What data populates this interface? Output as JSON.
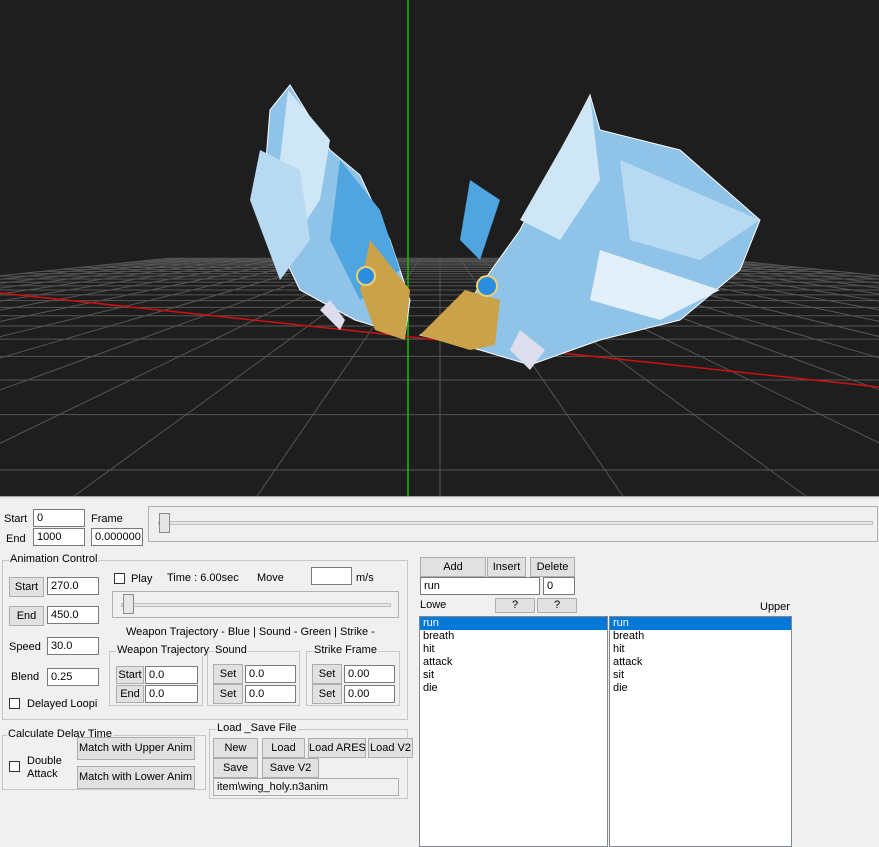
{
  "timeline": {
    "start_label": "Start",
    "start_value": "0",
    "end_label": "End",
    "end_value": "1000",
    "frame_label": "Frame",
    "frame_value": "0.000000"
  },
  "animation_control": {
    "title": "Animation Control",
    "start_button": "Start",
    "start_value": "270.0",
    "end_button": "End",
    "end_value": "450.0",
    "speed_label": "Speed",
    "speed_value": "30.0",
    "blend_label": "Blend",
    "blend_value": "0.25",
    "delayed_loop_label": "Delayed Loopi",
    "play_label": "Play",
    "time_label": "Time : 6.00sec",
    "move_label": "Move",
    "move_value": "",
    "move_unit": "m/s",
    "legend_text": "Weapon Trajectory - Blue | Sound - Green | Strike -",
    "weapon_trajectory": {
      "title": "Weapon Trajectory",
      "start_button": "Start",
      "start_value": "0.0",
      "end_button": "End",
      "end_value": "0.0"
    },
    "sound": {
      "title": "Sound",
      "set1_button": "Set",
      "set1_value": "0.0",
      "set2_button": "Set",
      "set2_value": "0.0"
    },
    "strike_frame": {
      "title": "Strike Frame",
      "set1_button": "Set",
      "set1_value": "0.00",
      "set2_button": "Set",
      "set2_value": "0.00"
    }
  },
  "delay": {
    "title": "Calculate Delay Time",
    "double_attack_label_1": "Double",
    "double_attack_label_2": "Attack",
    "match_upper_button": "Match with Upper Anim",
    "match_lower_button": "Match with Lower Anim"
  },
  "load_save": {
    "title": "Load _Save File",
    "new_button": "New",
    "load_button": "Load",
    "load_ares_button": "Load ARES",
    "load_v2_button": "Load V2",
    "save_button": "Save",
    "save_v2_button": "Save V2",
    "file_path": "item\\wing_holy.n3anim"
  },
  "anim_list": {
    "add_button": "Add",
    "insert_button": "Insert",
    "delete_button": "Delete",
    "name_value": "run",
    "index_value": "0",
    "lower_label": "Lowe",
    "help1_button": "?",
    "help2_button": "?",
    "upper_label": "Upper",
    "lower_items": [
      "run",
      "breath",
      "hit",
      "attack",
      "sit",
      "die"
    ],
    "upper_items": [
      "run",
      "breath",
      "hit",
      "attack",
      "sit",
      "die"
    ],
    "selected_index": 0
  },
  "colors": {
    "viewport_bg": "#1e1e1e",
    "grid": "#555555",
    "x_axis": "#d01010",
    "y_axis": "#10c010",
    "selection": "#0078d7"
  }
}
